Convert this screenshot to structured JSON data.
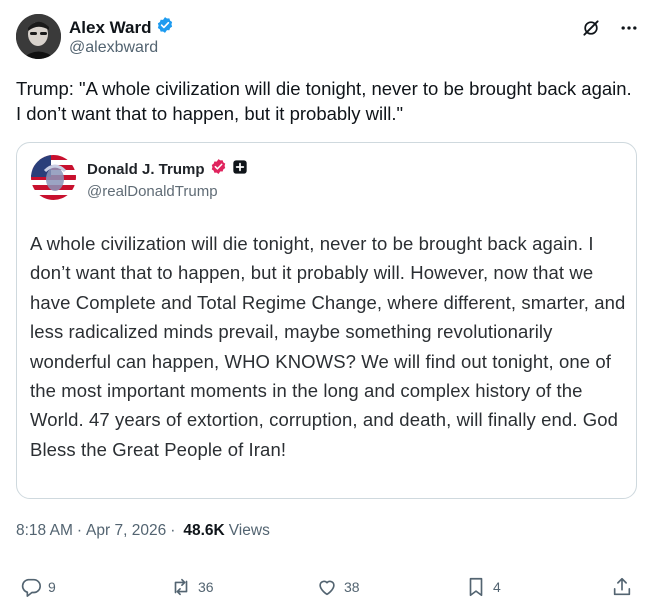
{
  "author": {
    "name": "Alex Ward",
    "handle": "@alexbward"
  },
  "tweet_text": "Trump: \"A whole civilization will die tonight, never to be brought back again. I don’t want that to happen, but it probably will.\"",
  "quote": {
    "name": "Donald J. Trump",
    "handle": "@realDonaldTrump",
    "text": "A whole civilization will die tonight, never to be brought back again. I don’t want that to happen, but it probably will. However, now that we have Complete and Total Regime Change, where different, smarter, and less radicalized minds prevail, maybe something revolutionarily wonderful can happen, WHO KNOWS? We will find out tonight, one of the most important moments in the long and complex history of the World. 47 years of extortion, corruption, and death, will finally end. God Bless the Great People of Iran!"
  },
  "meta": {
    "time": "8:18 AM",
    "separator": "·",
    "date": "Apr 7, 2026",
    "views_count": "48.6K",
    "views_label": "Views"
  },
  "actions": {
    "replies": "9",
    "reposts": "36",
    "likes": "38",
    "bookmarks": "4"
  },
  "icons": {
    "verified": "verified-badge-icon",
    "grok": "grok-icon",
    "more": "more-icon",
    "quote_badge": "pink-verified-badge-icon",
    "plus": "plus-badge-icon"
  },
  "colors": {
    "verified_blue": "#1d9bf0",
    "pink_badge": "#e0245e",
    "text_secondary": "#536471",
    "border": "#cfd9de"
  }
}
